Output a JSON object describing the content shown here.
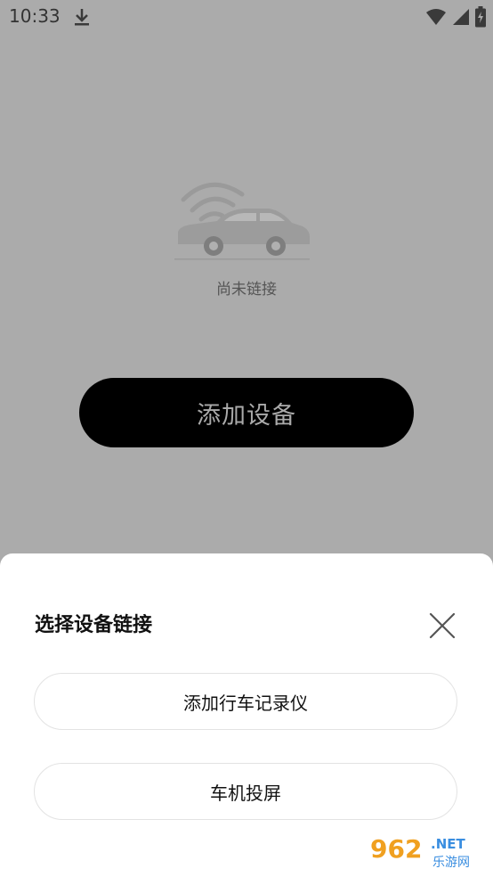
{
  "status_bar": {
    "time": "10:33",
    "icons": [
      "download-icon",
      "wifi-icon",
      "signal-icon",
      "battery-charging-icon"
    ]
  },
  "main": {
    "status_text": "尚未链接",
    "add_device_label": "添加设备"
  },
  "sheet": {
    "title": "选择设备链接",
    "options": [
      {
        "label": "添加行车记录仪"
      },
      {
        "label": "车机投屏"
      }
    ],
    "close_icon": "close-icon"
  },
  "watermark": {
    "brand": "962",
    "suffix": ".NET",
    "subtitle": "乐游网"
  },
  "colors": {
    "overlay_bg": "#ababab",
    "primary_button": "#000000",
    "sheet_bg": "#ffffff"
  }
}
